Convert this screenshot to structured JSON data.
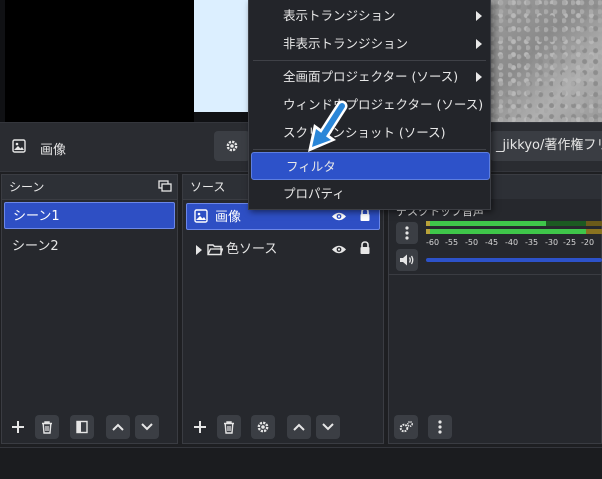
{
  "source_bar": {
    "label": "画像",
    "path_text": "_jikkyo/著作権フリー"
  },
  "context_menu": {
    "items": [
      {
        "label": "表示トランジション",
        "submenu": true
      },
      {
        "label": "非表示トランジション",
        "submenu": true
      },
      {
        "label": "全画面プロジェクター (ソース)",
        "submenu": true
      },
      {
        "label": "ウィンドウプロジェクター (ソース)",
        "submenu": false
      },
      {
        "label": "スクリーンショット (ソース)",
        "submenu": false
      },
      {
        "label": "フィルタ",
        "submenu": false,
        "highlighted": true
      },
      {
        "label": "プロパティ",
        "submenu": false
      }
    ]
  },
  "scenes": {
    "title": "シーン",
    "items": [
      {
        "label": "シーン1",
        "selected": true
      },
      {
        "label": "シーン2",
        "selected": false
      }
    ]
  },
  "sources": {
    "title": "ソース",
    "items": [
      {
        "label": "画像",
        "type": "image",
        "selected": true
      },
      {
        "label": "色ソース",
        "type": "group",
        "selected": false
      }
    ]
  },
  "audio": {
    "channel_label": "デスクトップ音声",
    "ticks": [
      "-60",
      "-55",
      "-50",
      "-45",
      "-40",
      "-35",
      "-30",
      "-25",
      "-20"
    ]
  },
  "colors": {
    "accent": "#2e4fc4",
    "meter_green": "#3fc64a",
    "meter_yellow": "#b8a23a",
    "arrow_blue": "#2a86d8"
  },
  "icons": [
    "image-icon",
    "gear-icon",
    "chevron-right-icon",
    "scenes-dock-icon",
    "plus-icon",
    "trash-icon",
    "filter-icon",
    "chevron-up-icon",
    "chevron-down-icon",
    "eye-icon",
    "lock-icon",
    "folder-icon",
    "more-icon",
    "speaker-icon",
    "cursor-arrow-icon"
  ]
}
